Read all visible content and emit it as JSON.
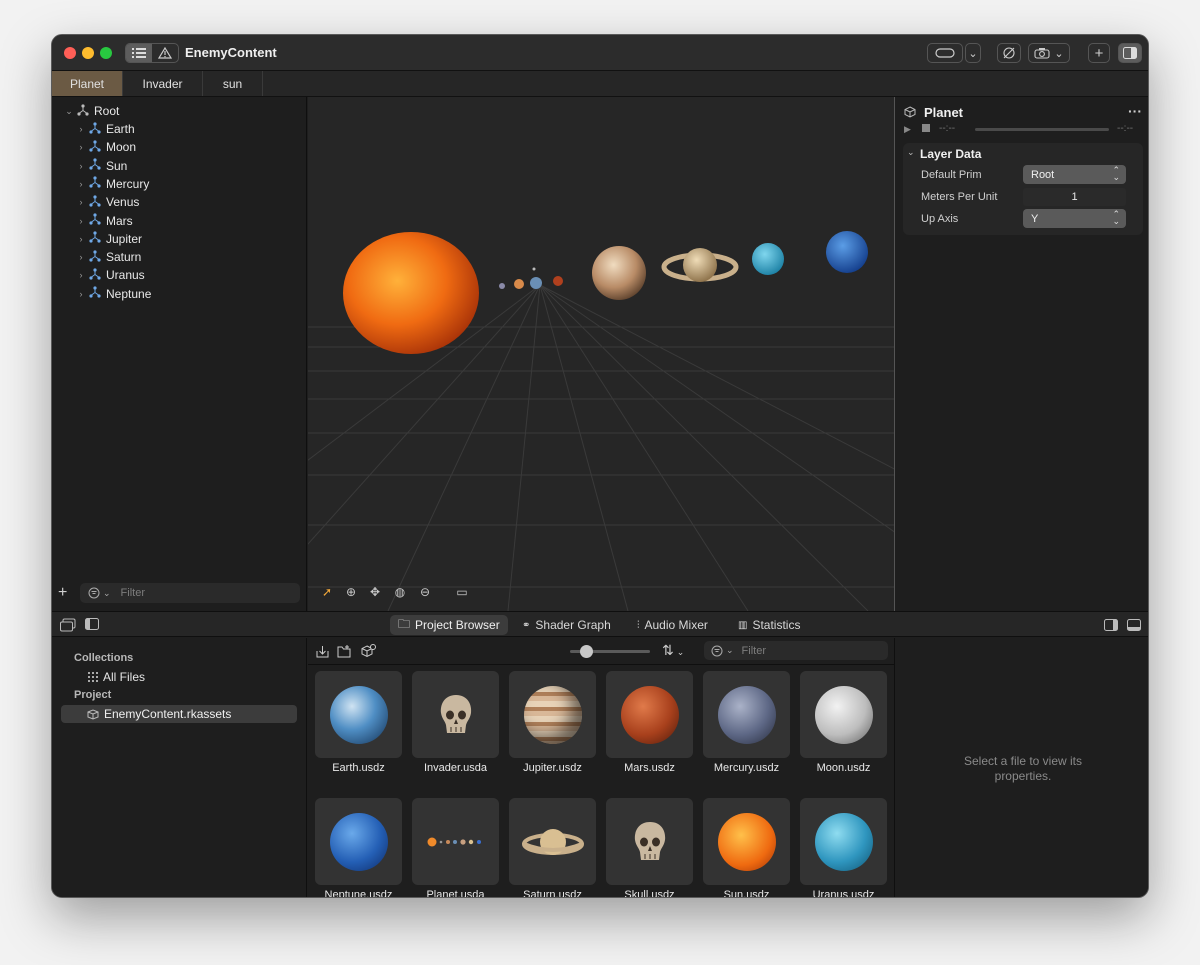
{
  "window": {
    "title": "EnemyContent"
  },
  "tabs": [
    {
      "label": "Planet"
    },
    {
      "label": "Invader"
    },
    {
      "label": "sun"
    }
  ],
  "hierarchy": {
    "root": "Root",
    "items": [
      "Earth",
      "Moon",
      "Sun",
      "Mercury",
      "Venus",
      "Mars",
      "Jupiter",
      "Saturn",
      "Uranus",
      "Neptune"
    ],
    "filter_placeholder": "Filter"
  },
  "inspector": {
    "title": "Planet",
    "more": "···",
    "timecode_start": "--:--",
    "timecode_end": "--:--",
    "section": "Layer Data",
    "default_prim_label": "Default Prim",
    "default_prim_value": "Root",
    "meters_label": "Meters Per Unit",
    "meters_value": "1",
    "up_axis_label": "Up Axis",
    "up_axis_value": "Y"
  },
  "bottom_tabs": [
    {
      "label": "Project Browser"
    },
    {
      "label": "Shader Graph"
    },
    {
      "label": "Audio Mixer"
    },
    {
      "label": "Statistics"
    }
  ],
  "collections": {
    "heading": "Collections",
    "all_files": "All Files",
    "project_heading": "Project",
    "project_item": "EnemyContent.rkassets"
  },
  "browser": {
    "filter_placeholder": "Filter",
    "zoom_level": 0.2,
    "assets": [
      {
        "name": "Earth.usdz",
        "icon": "earth-thumbnail"
      },
      {
        "name": "Invader.usda",
        "icon": "skull-thumbnail"
      },
      {
        "name": "Jupiter.usdz",
        "icon": "jupiter-thumbnail"
      },
      {
        "name": "Mars.usdz",
        "icon": "mars-thumbnail"
      },
      {
        "name": "Mercury.usdz",
        "icon": "mercury-thumbnail"
      },
      {
        "name": "Moon.usdz",
        "icon": "moon-thumbnail"
      },
      {
        "name": "Neptune.usdz",
        "icon": "neptune-thumbnail"
      },
      {
        "name": "Planet.usda",
        "icon": "solar-system-thumbnail"
      },
      {
        "name": "Saturn.usdz",
        "icon": "saturn-thumbnail"
      },
      {
        "name": "Skull.usdz",
        "icon": "skull-thumbnail"
      },
      {
        "name": "Sun.usdz",
        "icon": "sun-thumbnail"
      },
      {
        "name": "Uranus.usdz",
        "icon": "uranus-thumbnail"
      }
    ]
  },
  "file_inspector": {
    "empty_message": "Select a file to view its properties."
  },
  "colors": {
    "accent_tab": "#6b5a44",
    "selection": "#3a3a3a",
    "window_bg": "#1e1e1e"
  }
}
